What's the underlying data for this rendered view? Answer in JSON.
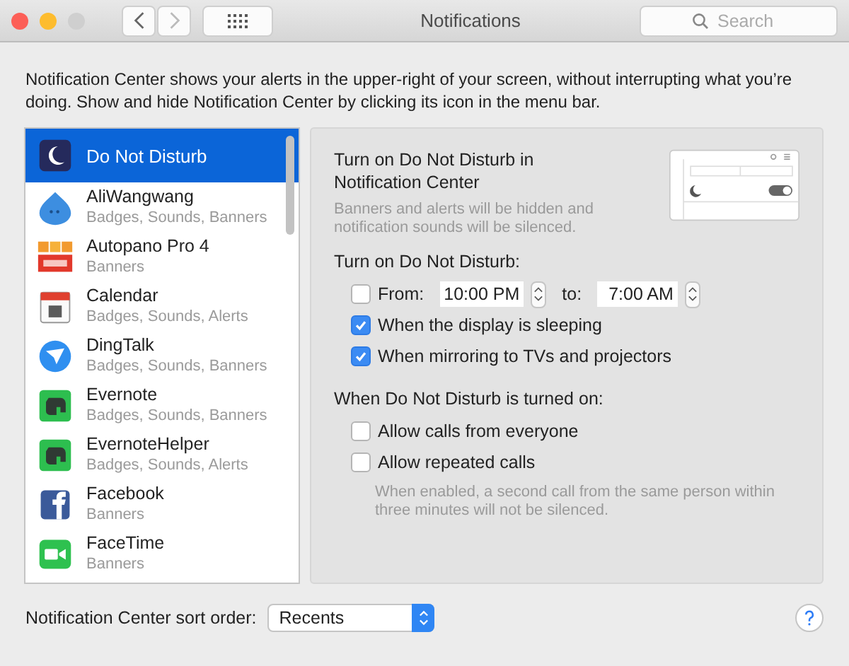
{
  "window": {
    "title": "Notifications"
  },
  "search": {
    "placeholder": "Search"
  },
  "description": "Notification Center shows your alerts in the upper-right of your screen, without interrupting what you’re doing. Show and hide Notification Center by clicking its icon in the menu bar.",
  "apps": [
    {
      "name": "Do Not Disturb",
      "selected": true
    },
    {
      "name": "AliWangwang",
      "subtitle": "Badges, Sounds, Banners",
      "selected": false
    },
    {
      "name": "Autopano Pro 4",
      "subtitle": "Banners",
      "selected": false
    },
    {
      "name": "Calendar",
      "subtitle": "Badges, Sounds, Alerts",
      "selected": false
    },
    {
      "name": "DingTalk",
      "subtitle": "Badges, Sounds, Banners",
      "selected": false
    },
    {
      "name": "Evernote",
      "subtitle": "Badges, Sounds, Banners",
      "selected": false
    },
    {
      "name": "EvernoteHelper",
      "subtitle": "Badges, Sounds, Alerts",
      "selected": false
    },
    {
      "name": "Facebook",
      "subtitle": "Banners",
      "selected": false
    },
    {
      "name": "FaceTime",
      "subtitle": "Banners",
      "selected": false
    }
  ],
  "dnd": {
    "heading": "Turn on Do Not Disturb in Notification Center",
    "note": "Banners and alerts will be hidden and notification sounds will be silenced.",
    "schedule_label": "Turn on Do Not Disturb:",
    "schedule": {
      "label": "From:",
      "checked": false,
      "start": "10:00 PM",
      "to_label": "to:",
      "end": "7:00 AM"
    },
    "options": [
      {
        "label": "When the display is sleeping",
        "checked": true
      },
      {
        "label": "When mirroring to TVs and projectors",
        "checked": true
      }
    ],
    "when_label": "When Do Not Disturb is turned on:",
    "call_options": [
      {
        "label": "Allow calls from everyone",
        "checked": false
      },
      {
        "label": "Allow repeated calls",
        "checked": false
      }
    ],
    "call_note": "When enabled, a second call from the same person within three minutes will not be silenced."
  },
  "sort": {
    "label": "Notification Center sort order:",
    "value": "Recents"
  }
}
